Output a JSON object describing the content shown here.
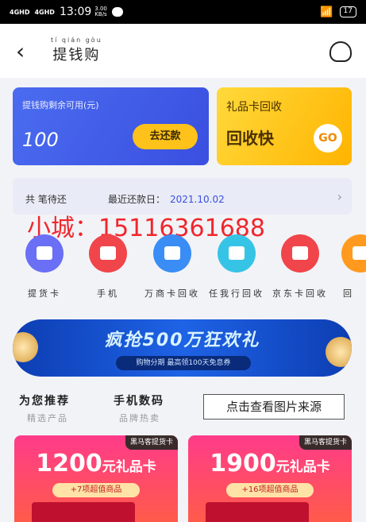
{
  "status_bar": {
    "signal1": "4GHD",
    "signal2": "4GHD",
    "time": "13:09",
    "speed_value": "3.00",
    "speed_unit": "KB/s",
    "battery": "17"
  },
  "header": {
    "title_pinyin": "tí qián gòu",
    "title": "提钱购"
  },
  "quota_card": {
    "label": "提钱购剩余可用(元)",
    "amount": "100",
    "button": "去还款"
  },
  "giftcard_card": {
    "label": "礼品卡回收",
    "tagline": "回收快",
    "button": "GO"
  },
  "repay_info": {
    "pending_label": "共 笔待还",
    "recent_label": "最近还款日：",
    "recent_date": "2021.10.02"
  },
  "overlay_contact": "小城：15116361688",
  "services": [
    {
      "label": "提货卡",
      "color": "#6a6ff5"
    },
    {
      "label": "手机",
      "color": "#f0454a"
    },
    {
      "label": "万商卡回收",
      "color": "#3a8df5"
    },
    {
      "label": "任我行回收",
      "color": "#36c4e6"
    },
    {
      "label": "京东卡回收",
      "color": "#f0454a"
    },
    {
      "label": "回",
      "color": "#ff9a1f"
    }
  ],
  "banner": {
    "headline": "疯抢500万狂欢礼",
    "subline": "购物分期 最高领100天免息券"
  },
  "sections": [
    {
      "title": "为您推荐",
      "subtitle": "精选产品"
    },
    {
      "title": "手机数码",
      "subtitle": "品牌热卖"
    }
  ],
  "source_button": "点击查看图片来源",
  "promos": [
    {
      "tag": "黑马客提货卡",
      "amount": "1200",
      "unit": "元礼品卡",
      "sub": "+7项超值商品"
    },
    {
      "tag": "黑马客提货卡",
      "amount": "1900",
      "unit": "元礼品卡",
      "sub": "+16项超值商品"
    }
  ]
}
